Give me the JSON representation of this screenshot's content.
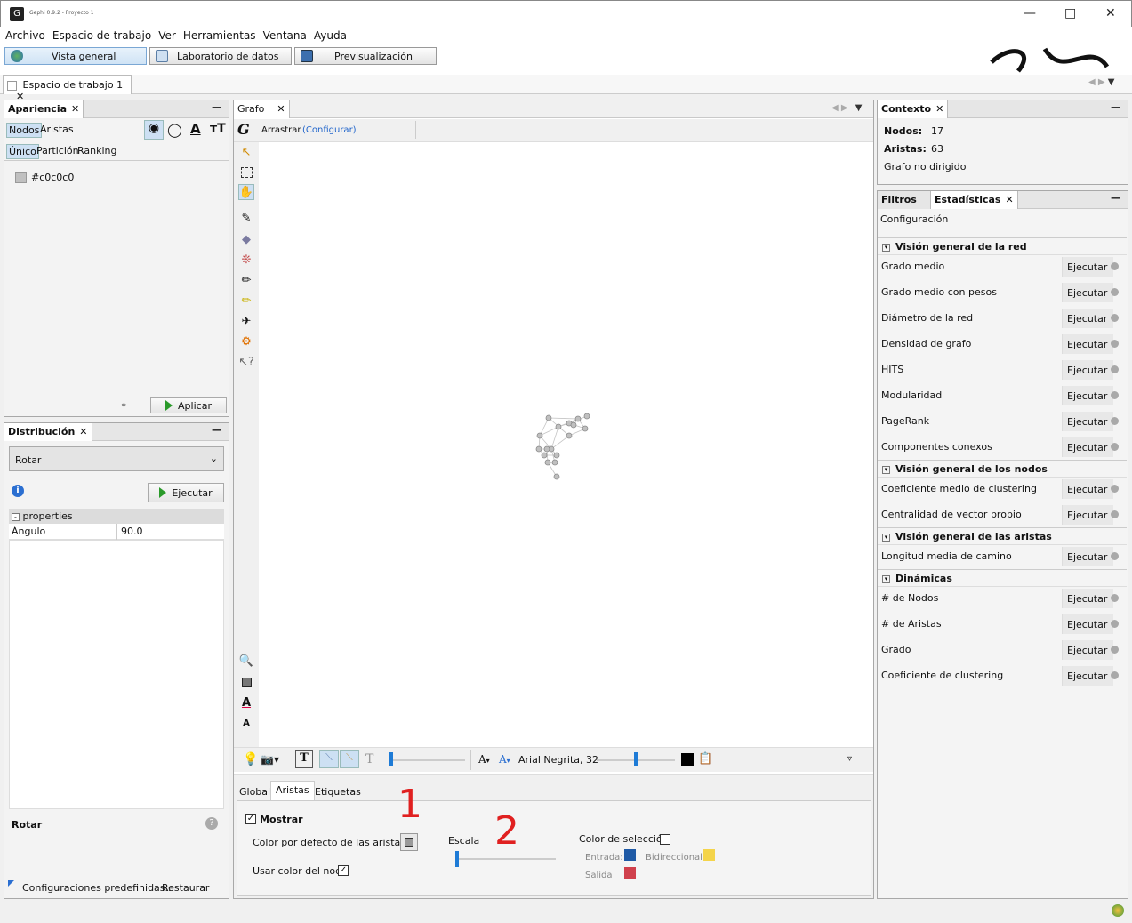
{
  "window": {
    "title": "Gephi 0.9.2 - Proyecto 1"
  },
  "menu": [
    "Archivo",
    "Espacio de trabajo",
    "Ver",
    "Herramientas",
    "Ventana",
    "Ayuda"
  ],
  "main_tabs": {
    "overview": "Vista general",
    "data_lab": "Laboratorio de datos",
    "preview": "Previsualización"
  },
  "workspace_tab": "Espacio de trabajo 1",
  "appearance": {
    "title": "Apariencia",
    "tabs": [
      "Nodos",
      "Aristas"
    ],
    "subtabs": [
      "Único",
      "Partición",
      "Ranking"
    ],
    "color_value": "#c0c0c0",
    "apply": "Aplicar"
  },
  "layout": {
    "title": "Distribución",
    "selected": "Rotar",
    "run": "Ejecutar",
    "properties_header": "properties",
    "prop_name": "Ángulo",
    "prop_value": "90.0",
    "desc_title": "Rotar",
    "presets": "Configuraciones predefinidas...",
    "restore": "Restaurar"
  },
  "graph": {
    "title": "Grafo",
    "mode": "Arrastrar",
    "configure": "(Configurar)",
    "font_label": "Arial Negrita, 32",
    "bottom_tabs": [
      "Global",
      "Aristas",
      "Etiquetas"
    ],
    "show": "Mostrar",
    "default_edge_color": "Color por defecto de las aristas:",
    "use_node_color": "Usar color del nodo",
    "scale": "Escala",
    "selection_color": "Color de selección",
    "in": "Entrada:",
    "out": "Salida",
    "bidir": "Bidireccional:",
    "annot1": "1",
    "annot2": "2",
    "colors": {
      "in": "#1f5aa6",
      "out": "#d0404c",
      "bidir": "#f4d44a",
      "annot": "#e02020"
    }
  },
  "context": {
    "title": "Contexto",
    "nodes_label": "Nodos:",
    "nodes_value": "17",
    "edges_label": "Aristas:",
    "edges_value": "63",
    "graph_type": "Grafo no dirigido"
  },
  "stats": {
    "tabs": [
      "Filtros",
      "Estadísticas"
    ],
    "config": "Configuración",
    "run_label": "Ejecutar",
    "sections": [
      {
        "title": "Visión general de la red",
        "items": [
          "Grado medio",
          "Grado medio con pesos",
          "Diámetro de la red",
          "Densidad de grafo",
          "HITS",
          "Modularidad",
          "PageRank",
          "Componentes conexos"
        ]
      },
      {
        "title": "Visión general de los nodos",
        "items": [
          "Coeficiente medio de clustering",
          "Centralidad de vector propio"
        ]
      },
      {
        "title": "Visión general de las aristas",
        "items": [
          "Longitud media de camino"
        ]
      },
      {
        "title": "Dinámicas",
        "items": [
          "# de Nodos",
          "# de Aristas",
          "Grado",
          "Coeficiente de clustering"
        ]
      }
    ]
  }
}
